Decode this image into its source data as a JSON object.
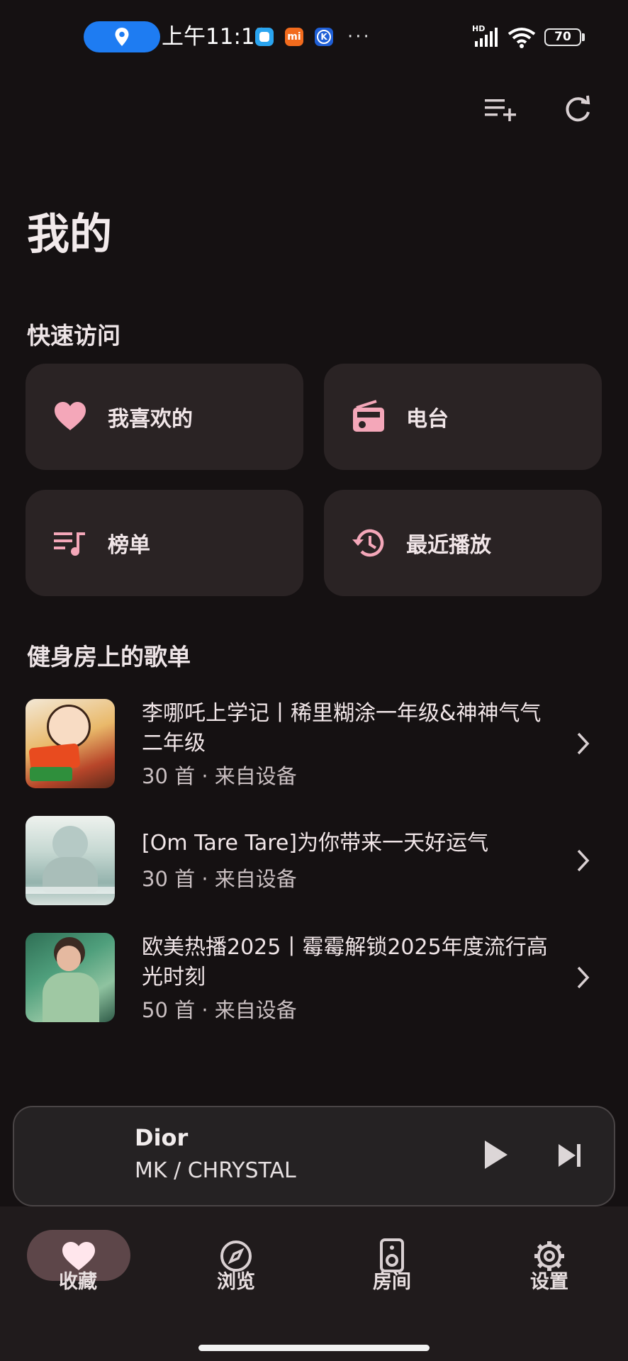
{
  "status_bar": {
    "time": "上午11:13",
    "more": "···",
    "battery": "70",
    "network_label": "HD"
  },
  "header": {
    "title": "我的"
  },
  "quick_access": {
    "title": "快速访问",
    "items": [
      {
        "label": "我喜欢的",
        "icon": "heart-icon"
      },
      {
        "label": "电台",
        "icon": "radio-icon"
      },
      {
        "label": "榜单",
        "icon": "chart-list-icon"
      },
      {
        "label": "最近播放",
        "icon": "history-icon"
      }
    ]
  },
  "playlists": {
    "title": "健身房上的歌单",
    "items": [
      {
        "title": "李哪吒上学记丨稀里糊涂一年级&神神气气二年级",
        "subtitle": "30 首 · 来自设备"
      },
      {
        "title": "[Om Tare Tare]为你带来一天好运气",
        "subtitle": "30 首 · 来自设备"
      },
      {
        "title": "欧美热播2025丨霉霉解锁2025年度流行高光时刻",
        "subtitle": "50 首 · 来自设备"
      }
    ]
  },
  "mini_player": {
    "title": "Dior",
    "artist": "MK / CHRYSTAL"
  },
  "bottom_nav": {
    "items": [
      {
        "label": "收藏",
        "icon": "heart-icon",
        "active": true
      },
      {
        "label": "浏览",
        "icon": "compass-icon",
        "active": false
      },
      {
        "label": "房间",
        "icon": "speaker-icon",
        "active": false
      },
      {
        "label": "设置",
        "icon": "gear-icon",
        "active": false
      }
    ]
  },
  "colors": {
    "background": "#151112",
    "card": "#2a2324",
    "accent_pink": "#f4a7b9",
    "active_pill": "#5d4649"
  }
}
